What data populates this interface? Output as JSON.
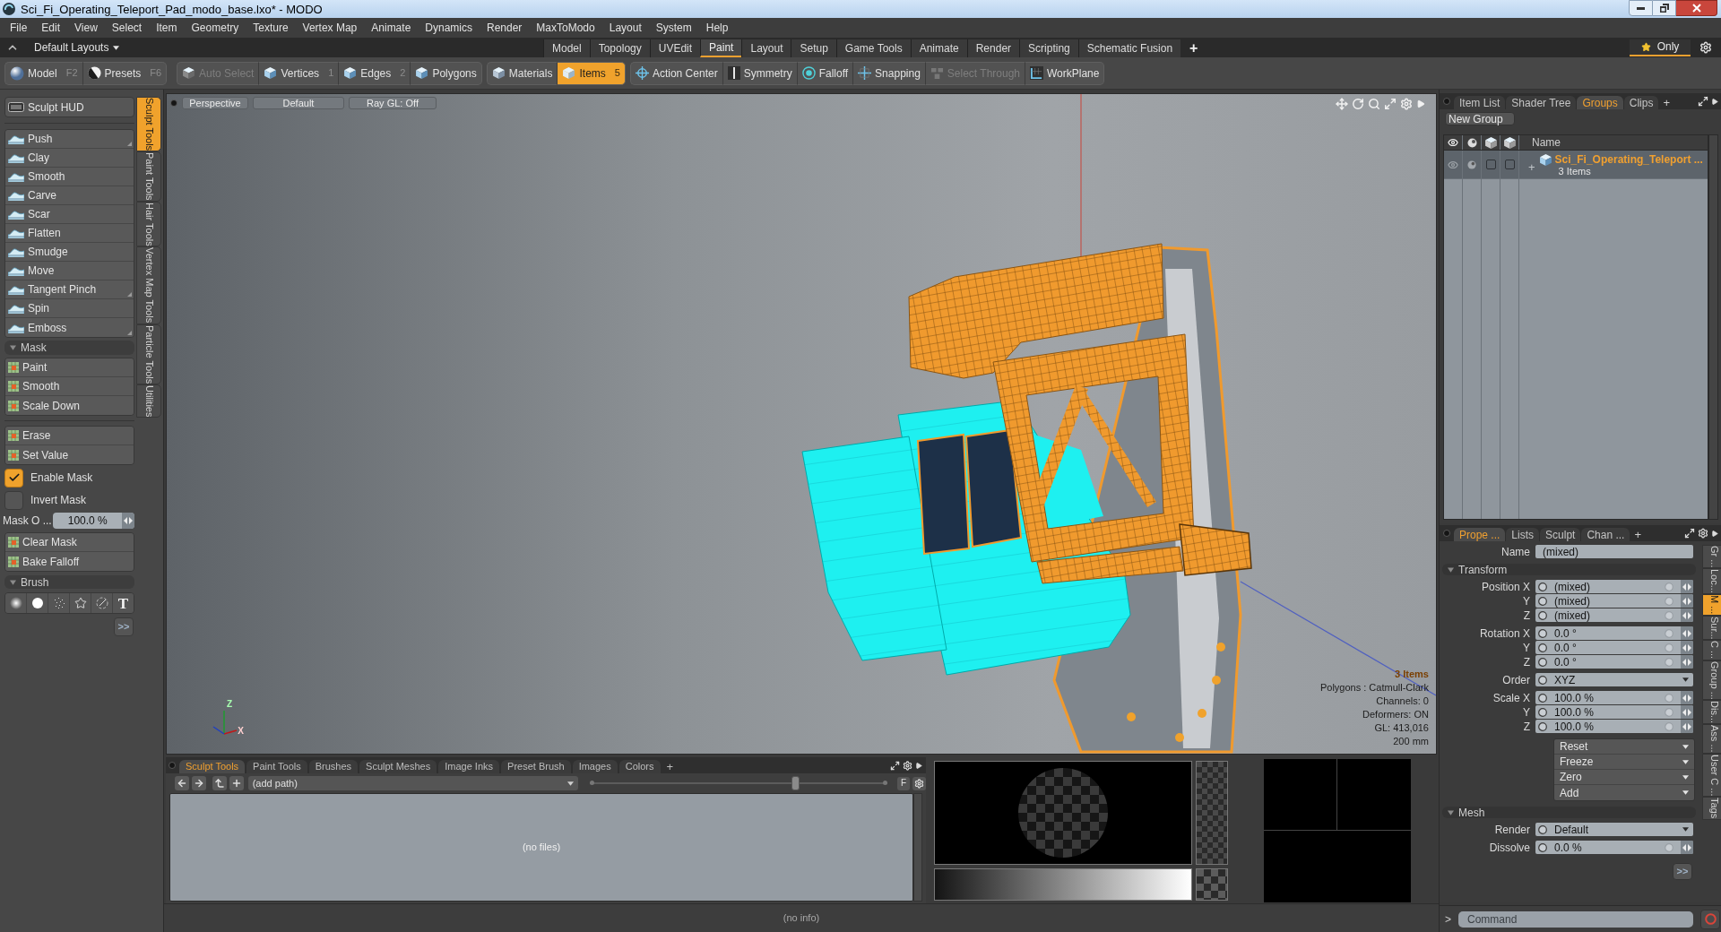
{
  "window": {
    "title": "Sci_Fi_Operating_Teleport_Pad_modo_base.lxo* - MODO"
  },
  "menu": [
    "File",
    "Edit",
    "View",
    "Select",
    "Item",
    "Geometry",
    "Texture",
    "Vertex Map",
    "Animate",
    "Dynamics",
    "Render",
    "MaxToModo",
    "Layout",
    "System",
    "Help"
  ],
  "layout_bar": {
    "layouts": "Default Layouts",
    "tabs": [
      {
        "label": "Model",
        "selected": false
      },
      {
        "label": "Topology",
        "selected": false
      },
      {
        "label": "UVEdit",
        "selected": false
      },
      {
        "label": "Paint",
        "selected": true
      },
      {
        "label": "Layout",
        "selected": false
      },
      {
        "label": "Setup",
        "selected": false
      },
      {
        "label": "Game Tools",
        "selected": false
      },
      {
        "label": "Animate",
        "selected": false
      },
      {
        "label": "Render",
        "selected": false
      },
      {
        "label": "Scripting",
        "selected": false
      },
      {
        "label": "Schematic Fusion",
        "selected": false
      }
    ],
    "add": "+",
    "filter": {
      "label": "Only",
      "on": true
    }
  },
  "toolbar": [
    {
      "items": [
        {
          "label": "Model",
          "shortcut": "F2",
          "selected": false,
          "disabled": false
        },
        {
          "label": "Presets",
          "shortcut": "F6",
          "selected": false,
          "disabled": false
        }
      ]
    },
    {
      "items": [
        {
          "label": "Auto Select",
          "selected": false,
          "disabled": true
        },
        {
          "label": "Vertices",
          "shortcut": "1",
          "selected": false,
          "disabled": false
        },
        {
          "label": "Edges",
          "shortcut": "2",
          "selected": false,
          "disabled": false
        },
        {
          "label": "Polygons",
          "selected": false,
          "disabled": false
        }
      ]
    },
    {
      "items": [
        {
          "label": "Materials",
          "selected": false,
          "disabled": false
        },
        {
          "label": "Items",
          "shortcut": "5",
          "selected": true,
          "disabled": false
        }
      ]
    },
    {
      "items": [
        {
          "label": "Action Center",
          "selected": false,
          "disabled": false
        },
        {
          "label": "Symmetry",
          "selected": false,
          "disabled": false
        },
        {
          "label": "Falloff",
          "selected": false,
          "disabled": false
        },
        {
          "label": "Snapping",
          "selected": false,
          "disabled": false
        },
        {
          "label": "Select Through",
          "selected": false,
          "disabled": true
        },
        {
          "label": "WorkPlane",
          "selected": false,
          "disabled": false
        }
      ]
    }
  ],
  "left_panel": {
    "hud": "Sculpt HUD",
    "tools": [
      {
        "label": "Push",
        "submenu": true
      },
      {
        "label": "Clay",
        "submenu": false
      },
      {
        "label": "Smooth",
        "submenu": false
      },
      {
        "label": "Carve",
        "submenu": false
      },
      {
        "label": "Scar",
        "submenu": false
      },
      {
        "label": "Flatten",
        "submenu": false
      },
      {
        "label": "Smudge",
        "submenu": false
      },
      {
        "label": "Move",
        "submenu": false
      },
      {
        "label": "Tangent Pinch",
        "submenu": true
      },
      {
        "label": "Spin",
        "submenu": false
      },
      {
        "label": "Emboss",
        "submenu": true
      }
    ],
    "mask": {
      "title": "Mask",
      "expanded": true,
      "tools": [
        "Paint",
        "Smooth",
        "Scale Down"
      ],
      "edit_tools": [
        "Erase",
        "Set Value"
      ],
      "toggles": [
        {
          "label": "Enable Mask",
          "checked": true
        },
        {
          "label": "Invert Mask",
          "checked": false
        }
      ],
      "opacity": {
        "label": "Mask O ...",
        "value": "100.0 %"
      },
      "actions": [
        "Clear Mask",
        "Bake Falloff"
      ]
    },
    "brush": {
      "title": "Brush",
      "expanded": true,
      "shapes": [
        {
          "kind": "soft"
        },
        {
          "kind": "hard"
        },
        {
          "kind": "spray"
        },
        {
          "kind": "star"
        },
        {
          "kind": "orbit"
        },
        {
          "kind": "text",
          "label": "T"
        }
      ],
      "more": ">>"
    },
    "tabs": [
      {
        "label": "Sculpt Tools",
        "selected": true
      },
      {
        "label": "Paint Tools",
        "selected": false
      },
      {
        "label": "Hair Tools",
        "selected": false
      },
      {
        "label": "Vertex Map Tools",
        "selected": false
      },
      {
        "label": "Particle Tools",
        "selected": false
      },
      {
        "label": "Utilities",
        "selected": false
      }
    ]
  },
  "viewport": {
    "buttons": [
      "Perspective",
      "Default",
      "Ray GL: Off"
    ],
    "axes": [
      "Z",
      "X"
    ],
    "info": {
      "selection": "3 Items",
      "lines": [
        "Polygons : Catmull-Clark",
        "Channels: 0",
        "Deformers: ON",
        "GL: 413,016",
        "200 mm"
      ]
    }
  },
  "browser": {
    "tabs": [
      {
        "label": "Sculpt Tools",
        "selected": true
      },
      {
        "label": "Paint Tools",
        "selected": false
      },
      {
        "label": "Brushes",
        "selected": false
      },
      {
        "label": "Sculpt Meshes",
        "selected": false
      },
      {
        "label": "Image Inks",
        "selected": false
      },
      {
        "label": "Preset Brush",
        "selected": false
      },
      {
        "label": "Images",
        "selected": false
      },
      {
        "label": "Colors",
        "selected": false
      }
    ],
    "add": "+",
    "path": "(add path)",
    "size": {
      "level": 0.69
    },
    "filter": "F",
    "empty": "(no files)"
  },
  "status_bar": "(no info)",
  "groups_panel": {
    "tabs": [
      {
        "label": "Item List",
        "selected": false
      },
      {
        "label": "Shader Tree",
        "selected": false
      },
      {
        "label": "Groups",
        "selected": true
      },
      {
        "label": "Clips",
        "selected": false
      }
    ],
    "add": "+",
    "new_group": "New Group",
    "column": "Name",
    "rows": [
      {
        "toggle": "+",
        "name": "Sci_Fi_Operating_Teleport ...",
        "count": "3 Items",
        "selected": true,
        "checks": [
          false,
          false
        ]
      }
    ]
  },
  "properties": {
    "tabs": [
      {
        "label": "Prope ...",
        "selected": true
      },
      {
        "label": "Lists",
        "selected": false
      },
      {
        "label": "Sculpt",
        "selected": false
      },
      {
        "label": "Chan ...",
        "selected": false
      }
    ],
    "add": "+",
    "name": {
      "label": "Name",
      "value": "(mixed)"
    },
    "sections": [
      {
        "title": "Transform",
        "expanded": true,
        "groups": [
          [
            {
              "label": "Position X",
              "value": "(mixed)",
              "kind": "number"
            },
            {
              "label": "Y",
              "value": "(mixed)",
              "kind": "number"
            },
            {
              "label": "Z",
              "value": "(mixed)",
              "kind": "number"
            }
          ],
          [
            {
              "label": "Rotation X",
              "value": "0.0 °",
              "kind": "number"
            },
            {
              "label": "Y",
              "value": "0.0 °",
              "kind": "number"
            },
            {
              "label": "Z",
              "value": "0.0 °",
              "kind": "number"
            }
          ],
          [
            {
              "label": "Order",
              "value": "XYZ",
              "kind": "dropdown"
            }
          ],
          [
            {
              "label": "Scale X",
              "value": "100.0 %",
              "kind": "number"
            },
            {
              "label": "Y",
              "value": "100.0 %",
              "kind": "number"
            },
            {
              "label": "Z",
              "value": "100.0 %",
              "kind": "number"
            }
          ]
        ],
        "actions": [
          "Reset",
          "Freeze",
          "Zero",
          "Add"
        ]
      },
      {
        "title": "Mesh",
        "expanded": true,
        "groups": [
          [
            {
              "label": "Render",
              "value": "Default",
              "kind": "dropdown"
            }
          ],
          [
            {
              "label": "Dissolve",
              "value": "0.0 %",
              "kind": "number"
            }
          ]
        ]
      }
    ],
    "more": ">>",
    "side_tabs": [
      {
        "label": "Gr ...",
        "selected": false
      },
      {
        "label": "Loc...",
        "selected": false
      },
      {
        "label": "M ...",
        "selected": true
      },
      {
        "label": "Sur...",
        "selected": false
      },
      {
        "label": "C ...",
        "selected": false
      },
      {
        "label": "Group ...",
        "selected": false
      },
      {
        "label": "Dis...",
        "selected": false
      },
      {
        "label": "Ass ...",
        "selected": false
      },
      {
        "label": "User C ...",
        "selected": false
      },
      {
        "label": "Tags",
        "selected": false
      }
    ]
  },
  "command": {
    "prompt": ">",
    "placeholder": "Command"
  }
}
